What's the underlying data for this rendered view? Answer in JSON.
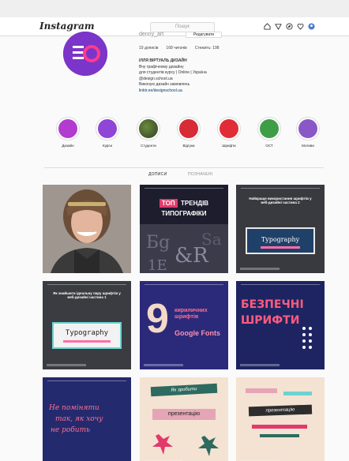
{
  "header": {
    "logo": "Instagram",
    "search_placeholder": "Пошук"
  },
  "nav_icons": [
    "home-icon",
    "explore-icon",
    "compass-icon",
    "heart-icon",
    "profile-icon"
  ],
  "profile": {
    "username": "denny_art",
    "edit_label": "Редагувати",
    "stats": [
      "19 дописів",
      "168 читачів",
      "Стежить: 198"
    ],
    "bio_name": "ІЛЛЯ ВІРТУАЛЬ ДИЗАЙН",
    "bio_lines": [
      "Вчу графічному дизайну",
      "для студентів курсу | Online | Україна",
      "@design.school.ua",
      "Виконую дизайн замовлень"
    ],
    "bio_link": "linktr.ee/designschool.ua"
  },
  "highlights": [
    {
      "label": "Дизайн",
      "color": "#b23bd0"
    },
    {
      "label": "Курси",
      "color": "#8f45d6"
    },
    {
      "label": "Студенти",
      "color": "#3f5f2f"
    },
    {
      "label": "Відгуки",
      "color": "#d72b36"
    },
    {
      "label": "Шрифти",
      "color": "#e12c38"
    },
    {
      "label": "ОСТ",
      "color": "#3e9e46"
    },
    {
      "label": "Мотиви",
      "color": "#8a57c7"
    }
  ],
  "tabs": {
    "posts": "ДОПИСИ",
    "tagged": "ПОЗНАЧЕНІ"
  },
  "posts": {
    "p2": {
      "line1": "ТОП",
      "line2": "ТРЕНДІВ",
      "line3": "ТИПОГРАФІКИ"
    },
    "p3": {
      "title": "Найкраще використання шрифтів у веб-дизайні частина 2",
      "label": "Typography"
    },
    "p4": {
      "title": "Як знайшити ідеальну пару шрифтів у веб-дизайні частина 1",
      "label": "Typography"
    },
    "p5": {
      "big": "9",
      "sub": "кириличних шрифтів",
      "brand": "Google Fonts"
    },
    "p6": {
      "line1": "БЕЗПЕЧНІ",
      "line2": "ШРИФТИ"
    },
    "p7": {
      "line1": "Не поміняти",
      "line2": "так, як хочу",
      "line3": "не робить"
    },
    "p8": {
      "top": "Як зробити",
      "mid": "презентацію"
    },
    "p9": {
      "mid": "презентацію"
    }
  }
}
